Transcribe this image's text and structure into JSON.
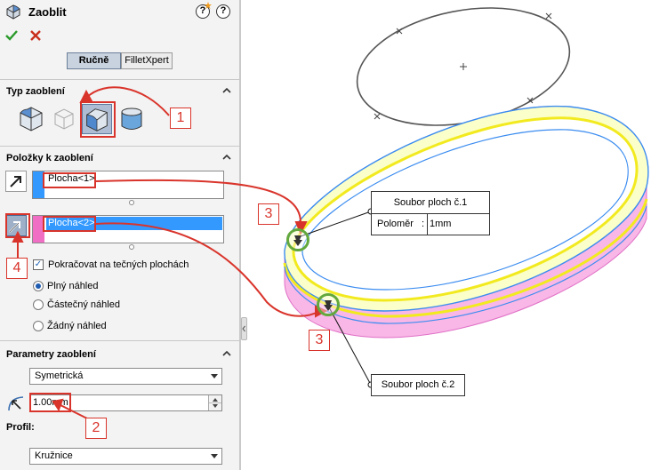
{
  "panel": {
    "title": "Zaoblit",
    "help_icon": "?",
    "tabs": [
      "Ručně",
      "FilletXpert"
    ],
    "fillet_type": {
      "heading": "Typ zaoblení"
    },
    "items": {
      "heading": "Položky k zaoblení",
      "list1": [
        "Plocha<1>"
      ],
      "list2": [
        "Plocha<2>"
      ],
      "tangent_propagation": "Pokračovat na tečných plochách",
      "preview_options": [
        "Plný náhled",
        "Částečný náhled",
        "Žádný náhled"
      ],
      "selected_preview": "Plný náhled"
    },
    "parameters": {
      "heading": "Parametry zaoblení",
      "method": "Symetrická",
      "radius": "1.00mm",
      "profile_label": "Profil:",
      "profile": "Kružnice"
    }
  },
  "callouts": [
    "1",
    "2",
    "3",
    "3",
    "4"
  ],
  "viewport": {
    "tag1": {
      "title": "Soubor ploch č.1",
      "param_label": "Poloměr",
      "colon": ":",
      "value": "1mm"
    },
    "tag2": {
      "title": "Soubor ploch č.2"
    }
  },
  "colors": {
    "accent_red": "#d9342b",
    "face1": "#3399ff",
    "face2": "#f06ec4",
    "yellow_edge": "#f5f53a",
    "green_ring": "#63a83d"
  }
}
